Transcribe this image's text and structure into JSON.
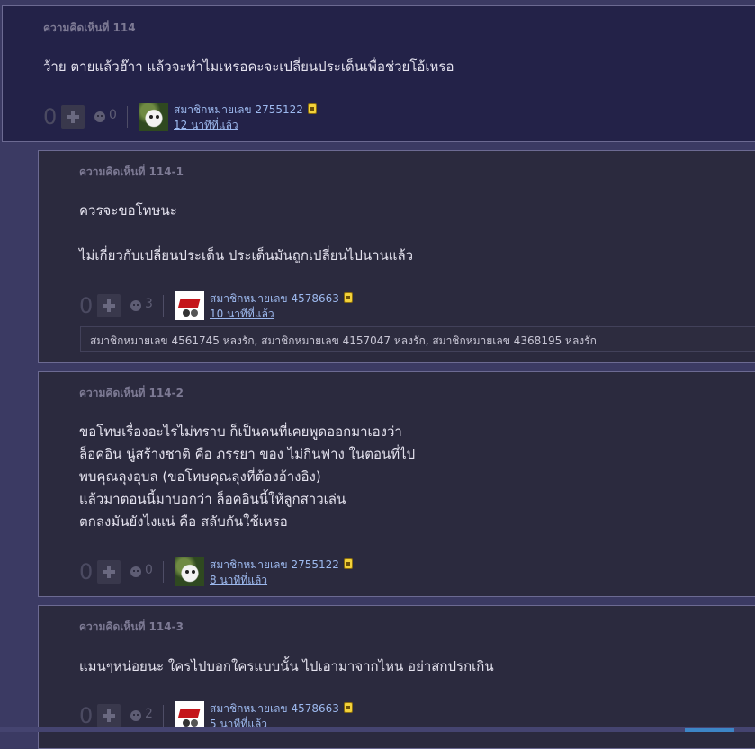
{
  "comments": [
    {
      "title": "ความคิดเห็นที่ 114",
      "lines": [
        "ว้าย ตายแล้วฮ๊าา แล้วจะทำไมเหรอคะจะเปลี่ยนประเด็นเพื่อช่วยโอ้เหรอ"
      ],
      "votes": "0",
      "emotions": "0",
      "username": "สมาชิกหมายเลข 2755122",
      "time": "12 นาทีที่แล้ว",
      "avatar": "cat-avatar"
    },
    {
      "title": "ความคิดเห็นที่ 114-1",
      "lines": [
        "ควรจะขอโทษนะ",
        "",
        "ไม่เกี่ยวกับเปลี่ยนประเด็น ประเด็นมันถูกเปลี่ยนไปนานแล้ว"
      ],
      "votes": "0",
      "emotions": "3",
      "username": "สมาชิกหมายเลข 4578663",
      "time": "10 นาทีที่แล้ว",
      "avatar": "wheelbarrow-avatar",
      "emotion_list": "สมาชิกหมายเลข 4561745 หลงรัก, สมาชิกหมายเลข 4157047 หลงรัก, สมาชิกหมายเลข 4368195 หลงรัก"
    },
    {
      "title": "ความคิดเห็นที่ 114-2",
      "lines": [
        "ขอโทษเรื่องอะไรไม่ทราบ ก็เป็นคนที่เคยพูดออกมาเองว่า",
        "ล็อคอิน นู่สร้างชาติ คือ ภรรยา ของ ไม่กินฟาง ในตอนที่ไป",
        "พบคุณลุงอุบล (ขอโทษคุณลุงที่ต้องอ้างอิง)",
        "แล้วมาตอนนี้มาบอกว่า ล็อคอินนี้ให้ลูกสาวเล่น",
        "ตกลงมันยังไงแน่ คือ สลับกันใช้เหรอ"
      ],
      "votes": "0",
      "emotions": "0",
      "username": "สมาชิกหมายเลข 2755122",
      "time": "8 นาทีที่แล้ว",
      "avatar": "cat-avatar"
    },
    {
      "title": "ความคิดเห็นที่ 114-3",
      "lines": [
        "แมนๆหน่อยนะ ใครไปบอกใครแบบนั้น ไปเอามาจากไหน อย่าสกปรกเกิน"
      ],
      "votes": "0",
      "emotions": "2",
      "username": "สมาชิกหมายเลข 4578663",
      "time": "5 นาทีที่แล้ว",
      "avatar": "wheelbarrow-avatar"
    }
  ]
}
